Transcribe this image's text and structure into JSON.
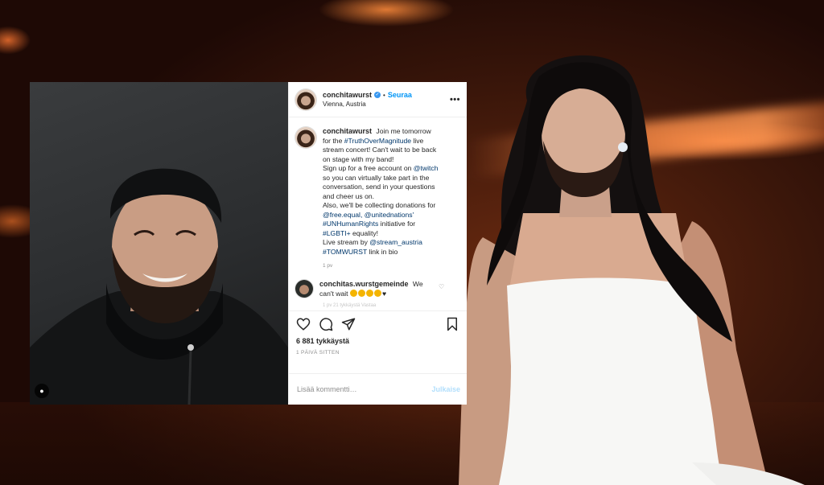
{
  "post": {
    "header": {
      "username": "conchitawurst",
      "follow_label": "Seuraa",
      "separator": "•",
      "location": "Vienna, Austria",
      "more_label": "•••"
    },
    "caption": {
      "username": "conchitawurst",
      "lines": [
        "Join me tomorrow",
        "for the #TruthOverMagnitude live",
        "stream concert! Can't wait to be back",
        "on stage with my band!",
        "Sign up for a free account on @twitch",
        "so you can virtually take part in the",
        "conversation, send in your questions",
        "and cheer us on.",
        "Also, we'll be collecting donations for",
        "@free.equal, @unitednations'",
        "#UNHumanRights initiative for",
        "#LGBTI+ equality!",
        "Live stream by @stream_austria",
        "#TOMWURST link in bio"
      ],
      "time": "1 pv"
    },
    "comment": {
      "username": "conchitas.wurstgemeinde",
      "text_start": "We",
      "text_end": "can't wait",
      "heart": "♡"
    },
    "faded_text": "1 pv   21 tykkäystä   Vastaa",
    "likes": "6 881 tykkäystä",
    "age": "1 päivä sitten",
    "add_comment": {
      "placeholder": "Lisää kommentti…",
      "post_label": "Julkaise"
    },
    "user_tag_icon": "person-icon"
  },
  "colors": {
    "link": "#00376b",
    "follow": "#0095f6",
    "verified": "#3897f0",
    "muted": "#8e8e8e"
  }
}
